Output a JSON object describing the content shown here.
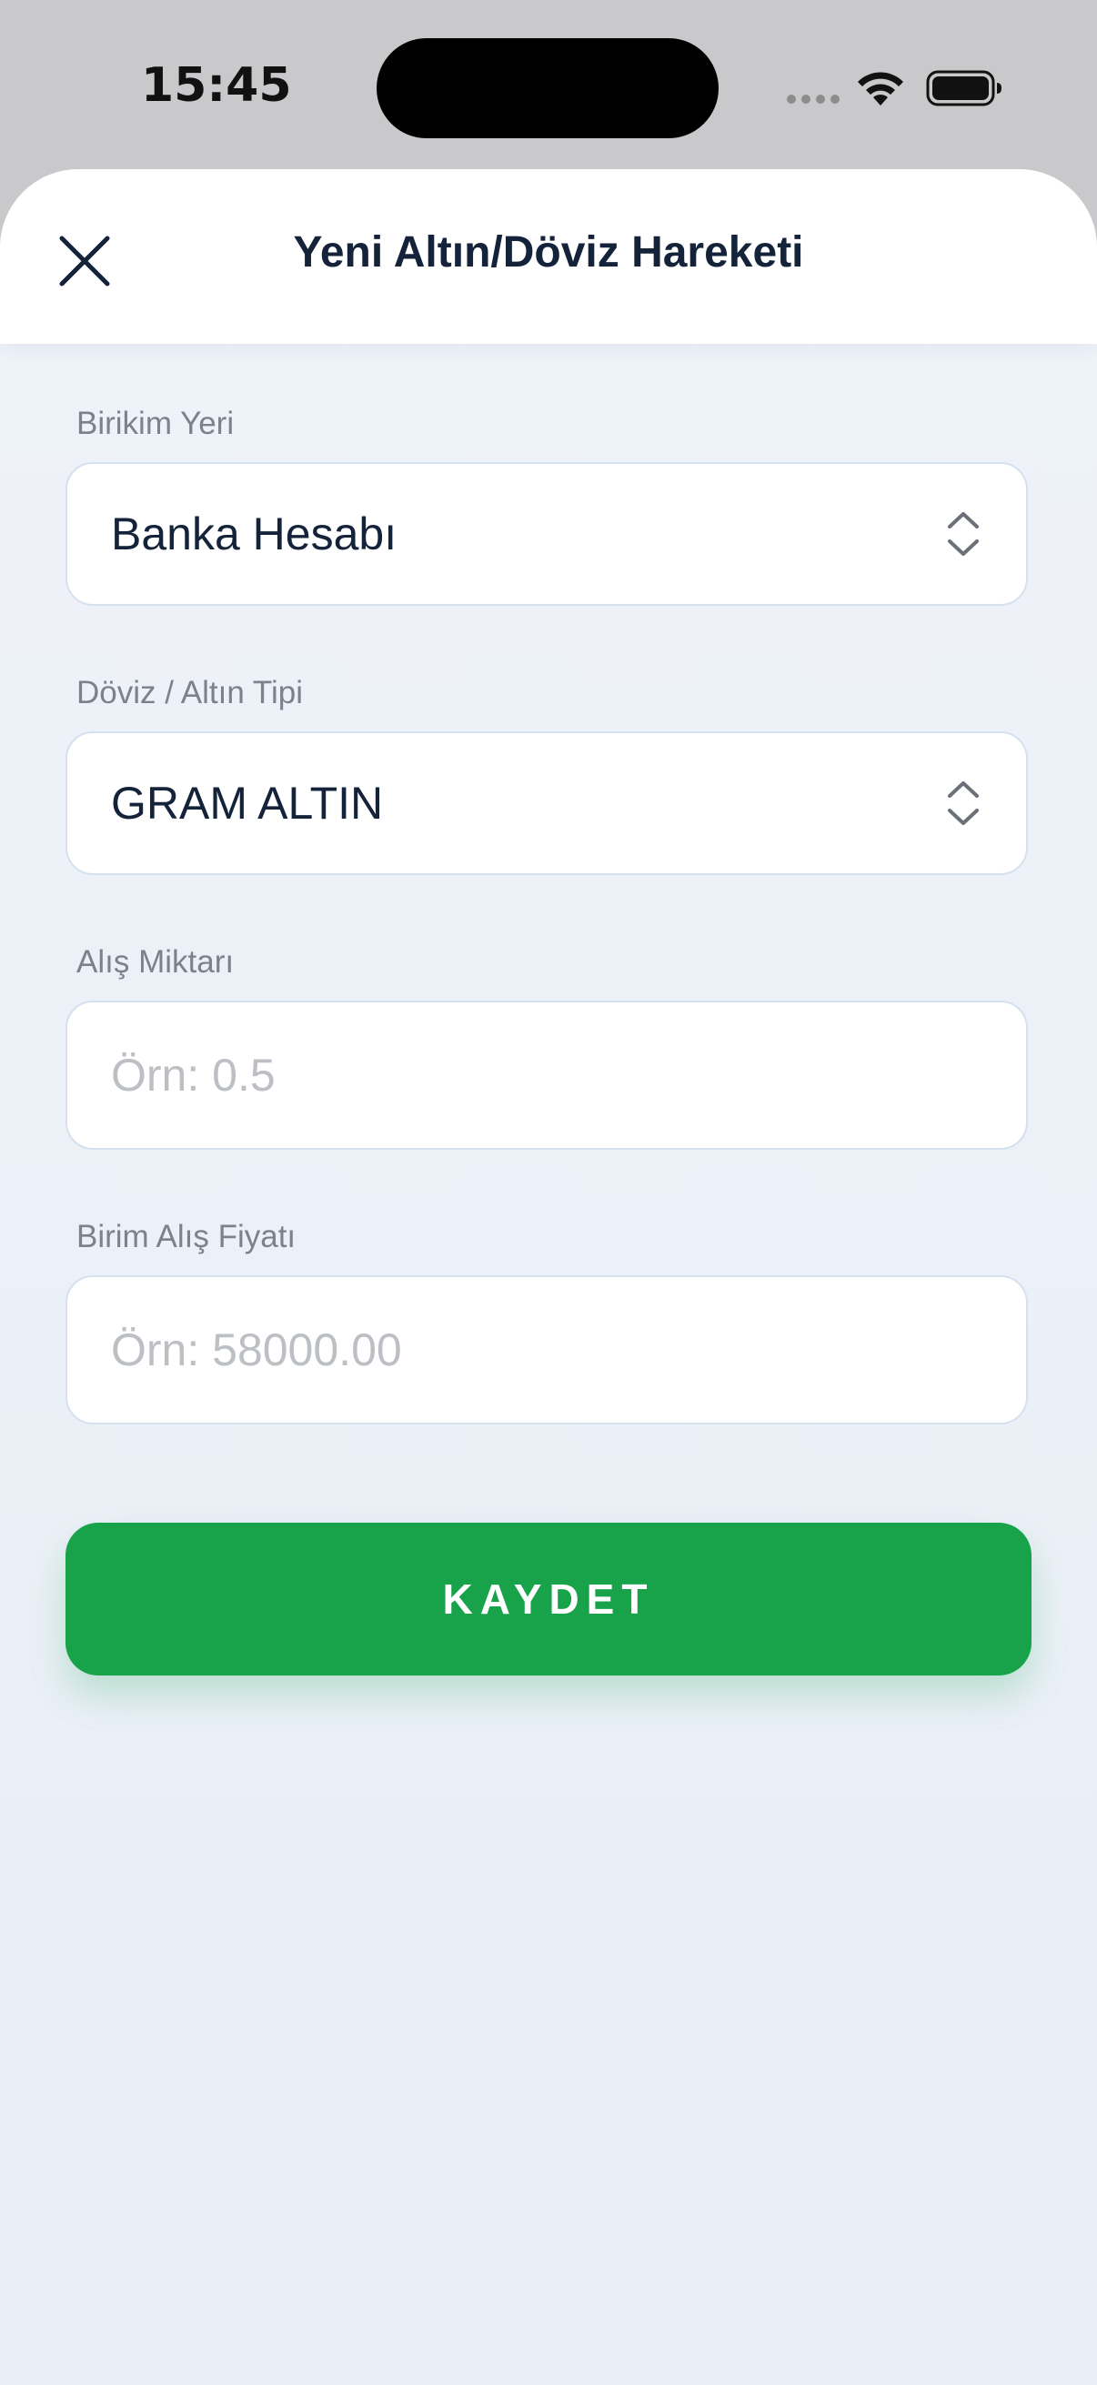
{
  "status_bar": {
    "time": "15:45"
  },
  "sheet": {
    "title": "Yeni Altın/Döviz Hareketi"
  },
  "form": {
    "savings_place": {
      "label": "Birikim Yeri",
      "value": "Banka Hesabı"
    },
    "currency_type": {
      "label": "Döviz / Altın Tipi",
      "value": "GRAM ALTIN"
    },
    "purchase_amount": {
      "label": "Alış Miktarı",
      "value": "",
      "placeholder": "Örn: 0.5"
    },
    "unit_price": {
      "label": "Birim Alış Fiyatı",
      "value": "",
      "placeholder": "Örn: 58000.00"
    }
  },
  "actions": {
    "save_label": "KAYDET"
  },
  "colors": {
    "accent": "#18a34a",
    "title_text": "#14233a",
    "label_text": "#7d8189",
    "placeholder_text": "#bcbfc4",
    "field_border": "#d5e1ee",
    "background": "#eff3f9"
  },
  "icons": {
    "close": "close-icon",
    "select_chevron": "chevron-up-down-icon",
    "wifi": "wifi-icon",
    "battery": "battery-icon"
  }
}
